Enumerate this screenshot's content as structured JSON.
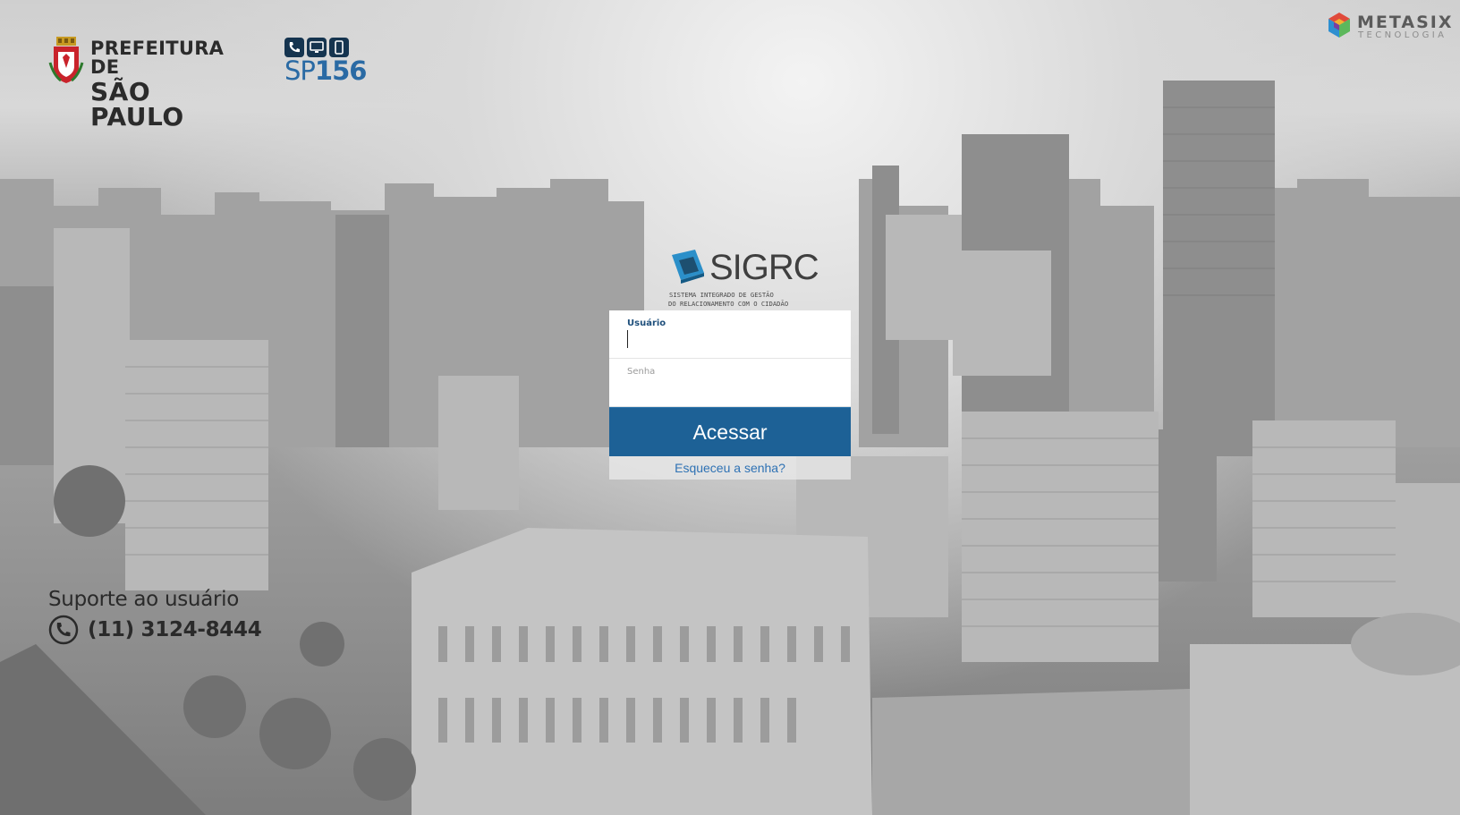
{
  "header": {
    "prefeitura_line1": "PREFEITURA DE",
    "prefeitura_line2": "SÃO PAULO",
    "sp156_prefix": "SP",
    "sp156_number": "156",
    "metasix_name": "METASIX",
    "metasix_sub": "TECNOLOGIA"
  },
  "sigrc": {
    "name": "SIGRC",
    "subtitle_line1": "SISTEMA INTEGRADO DE GESTÃO",
    "subtitle_line2": "DO RELACIONAMENTO COM O CIDADÃO"
  },
  "login": {
    "user_label": "Usuário",
    "user_value": "",
    "password_label": "Senha",
    "password_value": "",
    "submit_label": "Acessar",
    "forgot_label": "Esqueceu a senha?"
  },
  "support": {
    "title": "Suporte ao usuário",
    "phone": "(11) 3124-8444"
  },
  "colors": {
    "button": "#1d6196",
    "link": "#2f72b4",
    "label_active": "#1e4f7b",
    "sigrc_cube": "#2b8fc9"
  },
  "icons": [
    "crest-icon",
    "phone-icon",
    "monitor-icon",
    "mobile-icon",
    "metasix-cube-icon",
    "sigrc-cube-icon",
    "support-phone-icon"
  ]
}
